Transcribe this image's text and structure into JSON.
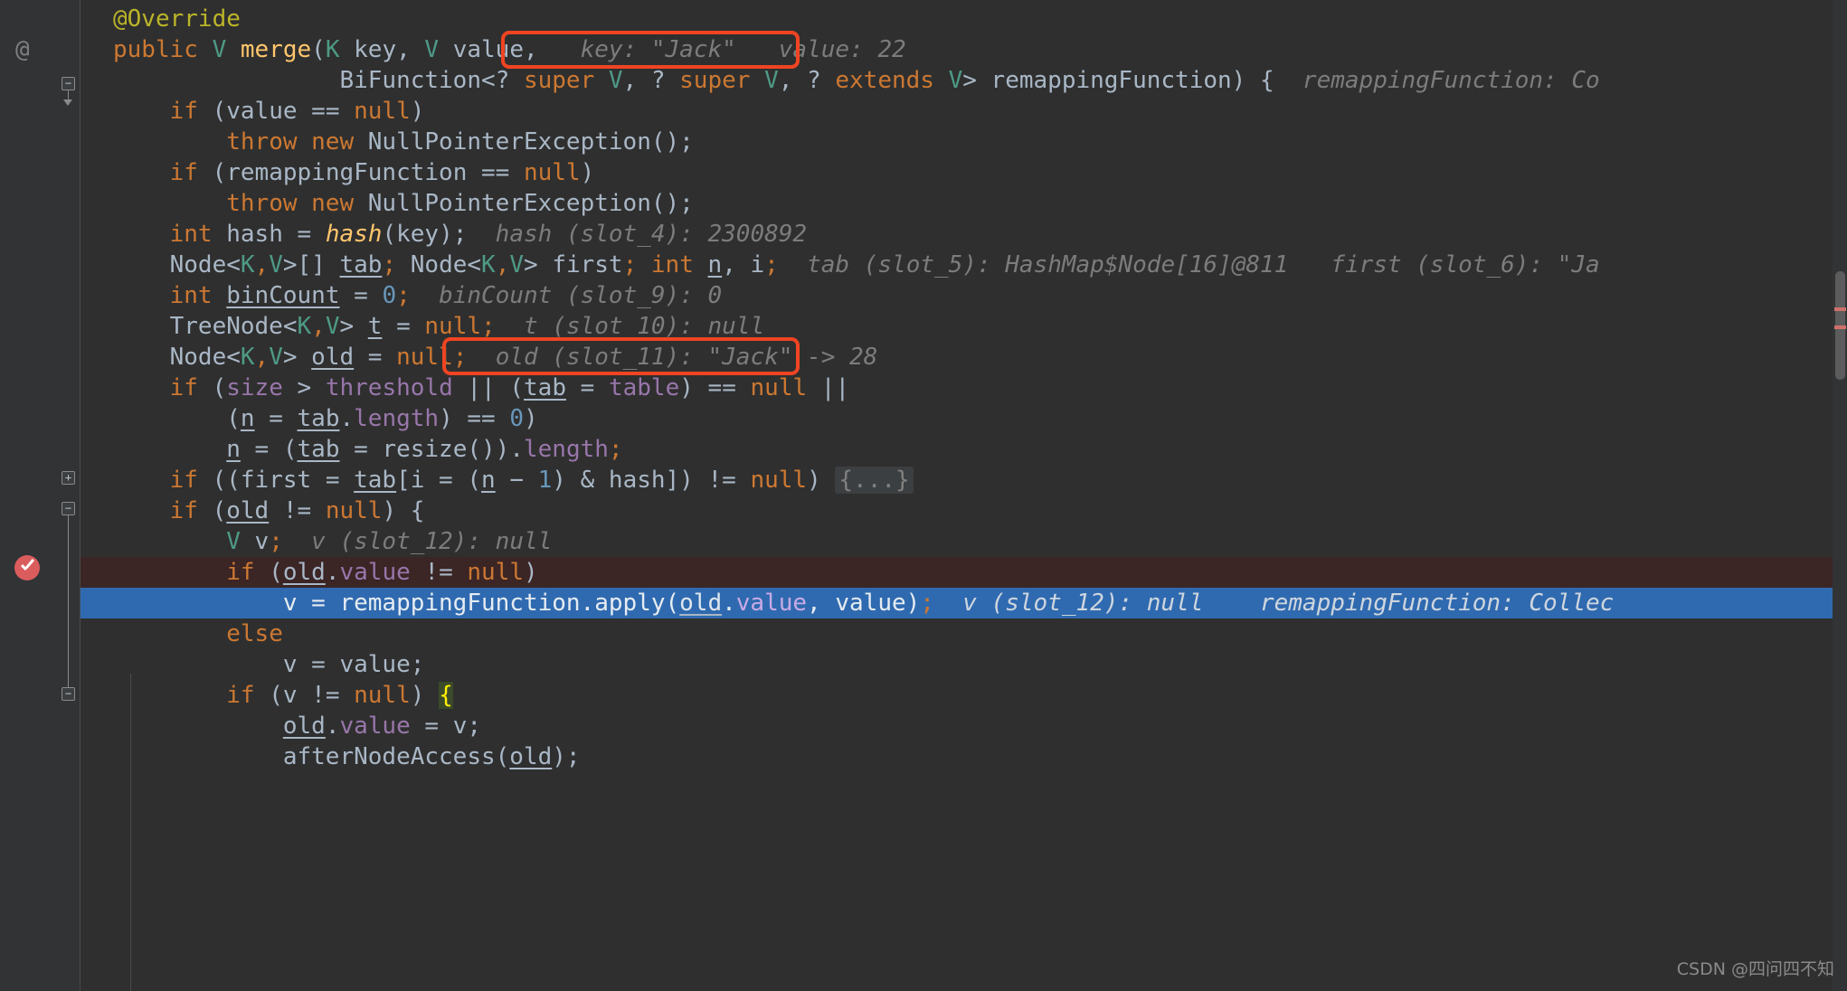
{
  "editor": {
    "app": "intellij-idea-debugger",
    "language": "java",
    "theme_background": "#2f2f2f",
    "gutter_background": "#313335",
    "current_execution_line_color": "#2f6ab0",
    "breakpoint_line_color": "#3b2525",
    "callout_color": "#f04423"
  },
  "gutter": {
    "annotation_marker": "@",
    "fold_collapse": "−",
    "fold_expand": "+"
  },
  "lines": [
    {
      "id": "l1",
      "indent": 2,
      "tokens": [
        {
          "t": "@Override",
          "c": "anno"
        }
      ]
    },
    {
      "id": "l2",
      "indent": 2,
      "tokens": [
        {
          "t": "public ",
          "c": "kw"
        },
        {
          "t": "V",
          "c": "type"
        },
        {
          "t": " ",
          "c": "punct"
        },
        {
          "t": "merge",
          "c": "method"
        },
        {
          "t": "(",
          "c": "punct"
        },
        {
          "t": "K",
          "c": "type"
        },
        {
          "t": " key, ",
          "c": "punct"
        },
        {
          "t": "V",
          "c": "type"
        },
        {
          "t": " value, ",
          "c": "punct"
        }
      ],
      "inline_hint": "key: \"Jack\"   value: 22",
      "hint_boxed": true
    },
    {
      "id": "l3",
      "indent": 2,
      "tokens": [
        {
          "t": "                BiFunction<? ",
          "c": "punct"
        },
        {
          "t": "super ",
          "c": "kw"
        },
        {
          "t": "V",
          "c": "type"
        },
        {
          "t": ", ? ",
          "c": "punct"
        },
        {
          "t": "super ",
          "c": "kw"
        },
        {
          "t": "V",
          "c": "type"
        },
        {
          "t": ", ? ",
          "c": "punct"
        },
        {
          "t": "extends ",
          "c": "kw"
        },
        {
          "t": "V",
          "c": "type"
        },
        {
          "t": "> remappingFunction) {",
          "c": "punct"
        }
      ],
      "inline_hint": "remappingFunction: Co"
    },
    {
      "id": "l4",
      "indent": 2,
      "tokens": [
        {
          "t": "    ",
          "c": "punct"
        },
        {
          "t": "if",
          "c": "kw"
        },
        {
          "t": " (value == ",
          "c": "punct"
        },
        {
          "t": "null",
          "c": "kw"
        },
        {
          "t": ")",
          "c": "punct"
        }
      ]
    },
    {
      "id": "l5",
      "indent": 2,
      "tokens": [
        {
          "t": "        ",
          "c": "punct"
        },
        {
          "t": "throw new ",
          "c": "kw"
        },
        {
          "t": "NullPointerException();",
          "c": "punct"
        }
      ]
    },
    {
      "id": "l6",
      "indent": 2,
      "tokens": [
        {
          "t": "    ",
          "c": "punct"
        },
        {
          "t": "if",
          "c": "kw"
        },
        {
          "t": " (remappingFunction == ",
          "c": "punct"
        },
        {
          "t": "null",
          "c": "kw"
        },
        {
          "t": ")",
          "c": "punct"
        }
      ]
    },
    {
      "id": "l7",
      "indent": 2,
      "tokens": [
        {
          "t": "        ",
          "c": "punct"
        },
        {
          "t": "throw new ",
          "c": "kw"
        },
        {
          "t": "NullPointerException();",
          "c": "punct"
        }
      ]
    },
    {
      "id": "l8",
      "indent": 2,
      "tokens": [
        {
          "t": "    ",
          "c": "punct"
        },
        {
          "t": "int",
          "c": "kw"
        },
        {
          "t": " hash = ",
          "c": "punct"
        },
        {
          "t": "hash",
          "c": "method-italic"
        },
        {
          "t": "(key);",
          "c": "punct"
        }
      ],
      "inline_hint": "hash (slot_4): 2300892"
    },
    {
      "id": "l9",
      "indent": 2,
      "tokens": [
        {
          "t": "    Node<",
          "c": "punct"
        },
        {
          "t": "K",
          "c": "type"
        },
        {
          "t": ",",
          "c": "kw"
        },
        {
          "t": "V",
          "c": "type"
        },
        {
          "t": ">[] ",
          "c": "punct"
        },
        {
          "t": "tab",
          "c": "uline"
        },
        {
          "t": "; ",
          "c": "kw"
        },
        {
          "t": "Node<",
          "c": "punct"
        },
        {
          "t": "K",
          "c": "type"
        },
        {
          "t": ",",
          "c": "kw"
        },
        {
          "t": "V",
          "c": "type"
        },
        {
          "t": "> first",
          "c": "punct"
        },
        {
          "t": "; ",
          "c": "kw"
        },
        {
          "t": "int",
          "c": "kw"
        },
        {
          "t": " ",
          "c": "punct"
        },
        {
          "t": "n",
          "c": "uline"
        },
        {
          "t": ", i",
          "c": "punct"
        },
        {
          "t": ";",
          "c": "kw"
        }
      ],
      "inline_hint": "tab (slot_5): HashMap$Node[16]@811   first (slot_6): \"Ja"
    },
    {
      "id": "l10",
      "indent": 2,
      "tokens": [
        {
          "t": "    ",
          "c": "punct"
        },
        {
          "t": "int",
          "c": "kw"
        },
        {
          "t": " ",
          "c": "punct"
        },
        {
          "t": "binCount",
          "c": "uline"
        },
        {
          "t": " = ",
          "c": "punct"
        },
        {
          "t": "0",
          "c": "num"
        },
        {
          "t": ";",
          "c": "kw"
        }
      ],
      "inline_hint": "binCount (slot_9): 0"
    },
    {
      "id": "l11",
      "indent": 2,
      "tokens": [
        {
          "t": "    TreeNode<",
          "c": "punct"
        },
        {
          "t": "K",
          "c": "type"
        },
        {
          "t": ",",
          "c": "kw"
        },
        {
          "t": "V",
          "c": "type"
        },
        {
          "t": "> ",
          "c": "punct"
        },
        {
          "t": "t",
          "c": "uline"
        },
        {
          "t": " = ",
          "c": "punct"
        },
        {
          "t": "null",
          "c": "kw"
        },
        {
          "t": ";",
          "c": "kw"
        }
      ],
      "inline_hint": "t (slot_10): null"
    },
    {
      "id": "l12",
      "indent": 2,
      "tokens": [
        {
          "t": "    Node<",
          "c": "punct"
        },
        {
          "t": "K",
          "c": "type"
        },
        {
          "t": ",",
          "c": "kw"
        },
        {
          "t": "V",
          "c": "type"
        },
        {
          "t": "> ",
          "c": "punct"
        },
        {
          "t": "old",
          "c": "uline"
        },
        {
          "t": " = ",
          "c": "punct"
        },
        {
          "t": "null",
          "c": "kw"
        },
        {
          "t": ";",
          "c": "kw"
        }
      ],
      "inline_hint": "old (slot_11): \"Jack\" -> 28",
      "hint_boxed": true
    },
    {
      "id": "l13",
      "indent": 2,
      "tokens": [
        {
          "t": "    ",
          "c": "punct"
        },
        {
          "t": "if",
          "c": "kw"
        },
        {
          "t": " (",
          "c": "punct"
        },
        {
          "t": "size",
          "c": "field"
        },
        {
          "t": " > ",
          "c": "punct"
        },
        {
          "t": "threshold",
          "c": "field"
        },
        {
          "t": " || (",
          "c": "punct"
        },
        {
          "t": "tab",
          "c": "uline"
        },
        {
          "t": " = ",
          "c": "punct"
        },
        {
          "t": "table",
          "c": "field"
        },
        {
          "t": ") == ",
          "c": "punct"
        },
        {
          "t": "null",
          "c": "kw"
        },
        {
          "t": " ||",
          "c": "punct"
        }
      ]
    },
    {
      "id": "l14",
      "indent": 2,
      "tokens": [
        {
          "t": "        (",
          "c": "punct"
        },
        {
          "t": "n",
          "c": "uline"
        },
        {
          "t": " = ",
          "c": "punct"
        },
        {
          "t": "tab",
          "c": "uline"
        },
        {
          "t": ".",
          "c": "punct"
        },
        {
          "t": "length",
          "c": "field"
        },
        {
          "t": ") == ",
          "c": "punct"
        },
        {
          "t": "0",
          "c": "num"
        },
        {
          "t": ")",
          "c": "punct"
        }
      ]
    },
    {
      "id": "l15",
      "indent": 2,
      "tokens": [
        {
          "t": "        ",
          "c": "punct"
        },
        {
          "t": "n",
          "c": "uline"
        },
        {
          "t": " = (",
          "c": "punct"
        },
        {
          "t": "tab",
          "c": "uline"
        },
        {
          "t": " = resize()).",
          "c": "punct"
        },
        {
          "t": "length",
          "c": "field"
        },
        {
          "t": ";",
          "c": "kw"
        }
      ]
    },
    {
      "id": "l16",
      "indent": 2,
      "tokens": [
        {
          "t": "    ",
          "c": "punct"
        },
        {
          "t": "if",
          "c": "kw"
        },
        {
          "t": " ((first = ",
          "c": "punct"
        },
        {
          "t": "tab",
          "c": "uline"
        },
        {
          "t": "[i = (",
          "c": "punct"
        },
        {
          "t": "n",
          "c": "uline"
        },
        {
          "t": " − ",
          "c": "punct"
        },
        {
          "t": "1",
          "c": "num"
        },
        {
          "t": ") & hash]) != ",
          "c": "punct"
        },
        {
          "t": "null",
          "c": "kw"
        },
        {
          "t": ") ",
          "c": "punct"
        }
      ],
      "fold_placeholder": "{...}"
    },
    {
      "id": "l17",
      "indent": 2,
      "tokens": [
        {
          "t": "    ",
          "c": "punct"
        },
        {
          "t": "if",
          "c": "kw"
        },
        {
          "t": " (",
          "c": "punct"
        },
        {
          "t": "old",
          "c": "uline"
        },
        {
          "t": " != ",
          "c": "punct"
        },
        {
          "t": "null",
          "c": "kw"
        },
        {
          "t": ") {",
          "c": "punct"
        }
      ]
    },
    {
      "id": "l18",
      "indent": 2,
      "tokens": [
        {
          "t": "        ",
          "c": "punct"
        },
        {
          "t": "V",
          "c": "type"
        },
        {
          "t": " v",
          "c": "punct"
        },
        {
          "t": ";",
          "c": "kw"
        }
      ],
      "inline_hint": "v (slot_12): null"
    },
    {
      "id": "l19",
      "indent": 2,
      "row_state": "breakpoint",
      "tokens": [
        {
          "t": "        ",
          "c": "punct"
        },
        {
          "t": "if",
          "c": "kw"
        },
        {
          "t": " (",
          "c": "punct"
        },
        {
          "t": "old",
          "c": "uline"
        },
        {
          "t": ".",
          "c": "punct"
        },
        {
          "t": "value",
          "c": "field"
        },
        {
          "t": " != ",
          "c": "punct"
        },
        {
          "t": "null",
          "c": "kw"
        },
        {
          "t": ")",
          "c": "punct"
        }
      ]
    },
    {
      "id": "l20",
      "indent": 2,
      "row_state": "executing",
      "tokens": [
        {
          "t": "            v = remappingFunction.apply(",
          "c": "punct"
        },
        {
          "t": "old",
          "c": "uline"
        },
        {
          "t": ".",
          "c": "punct"
        },
        {
          "t": "value",
          "c": "field"
        },
        {
          "t": ", value)",
          "c": "punct"
        },
        {
          "t": ";",
          "c": "kw"
        }
      ],
      "inline_hint": "v (slot_12): null    remappingFunction: Collec"
    },
    {
      "id": "l21",
      "indent": 2,
      "tokens": [
        {
          "t": "        ",
          "c": "punct"
        },
        {
          "t": "else",
          "c": "kw"
        }
      ]
    },
    {
      "id": "l22",
      "indent": 2,
      "tokens": [
        {
          "t": "            v = value;",
          "c": "punct"
        }
      ]
    },
    {
      "id": "l23",
      "indent": 2,
      "tokens": [
        {
          "t": "        ",
          "c": "punct"
        },
        {
          "t": "if",
          "c": "kw"
        },
        {
          "t": " (v != ",
          "c": "punct"
        },
        {
          "t": "null",
          "c": "kw"
        },
        {
          "t": ") ",
          "c": "punct"
        },
        {
          "t": "{",
          "c": "brace-hl"
        }
      ]
    },
    {
      "id": "l24",
      "indent": 2,
      "tokens": [
        {
          "t": "            ",
          "c": "punct"
        },
        {
          "t": "old",
          "c": "uline"
        },
        {
          "t": ".",
          "c": "punct"
        },
        {
          "t": "value",
          "c": "field"
        },
        {
          "t": " = v;",
          "c": "punct"
        }
      ]
    },
    {
      "id": "l25",
      "indent": 2,
      "tokens": [
        {
          "t": "            afterNodeAccess(",
          "c": "punct"
        },
        {
          "t": "old",
          "c": "uline"
        },
        {
          "t": ");",
          "c": "punct"
        }
      ]
    }
  ],
  "callouts": [
    {
      "name": "key-value-hint-callout",
      "label": "key: \"Jack\"   value: 22"
    },
    {
      "name": "old-slot-hint-callout",
      "label": "old (slot_11): \"Jack\" -> 28"
    }
  ],
  "breakpoint": {
    "name": "conditional-breakpoint",
    "line_id": "l19"
  },
  "scrollbar": {
    "name": "editor-vertical-scrollbar"
  },
  "watermark": {
    "text": "CSDN @四问四不知"
  }
}
